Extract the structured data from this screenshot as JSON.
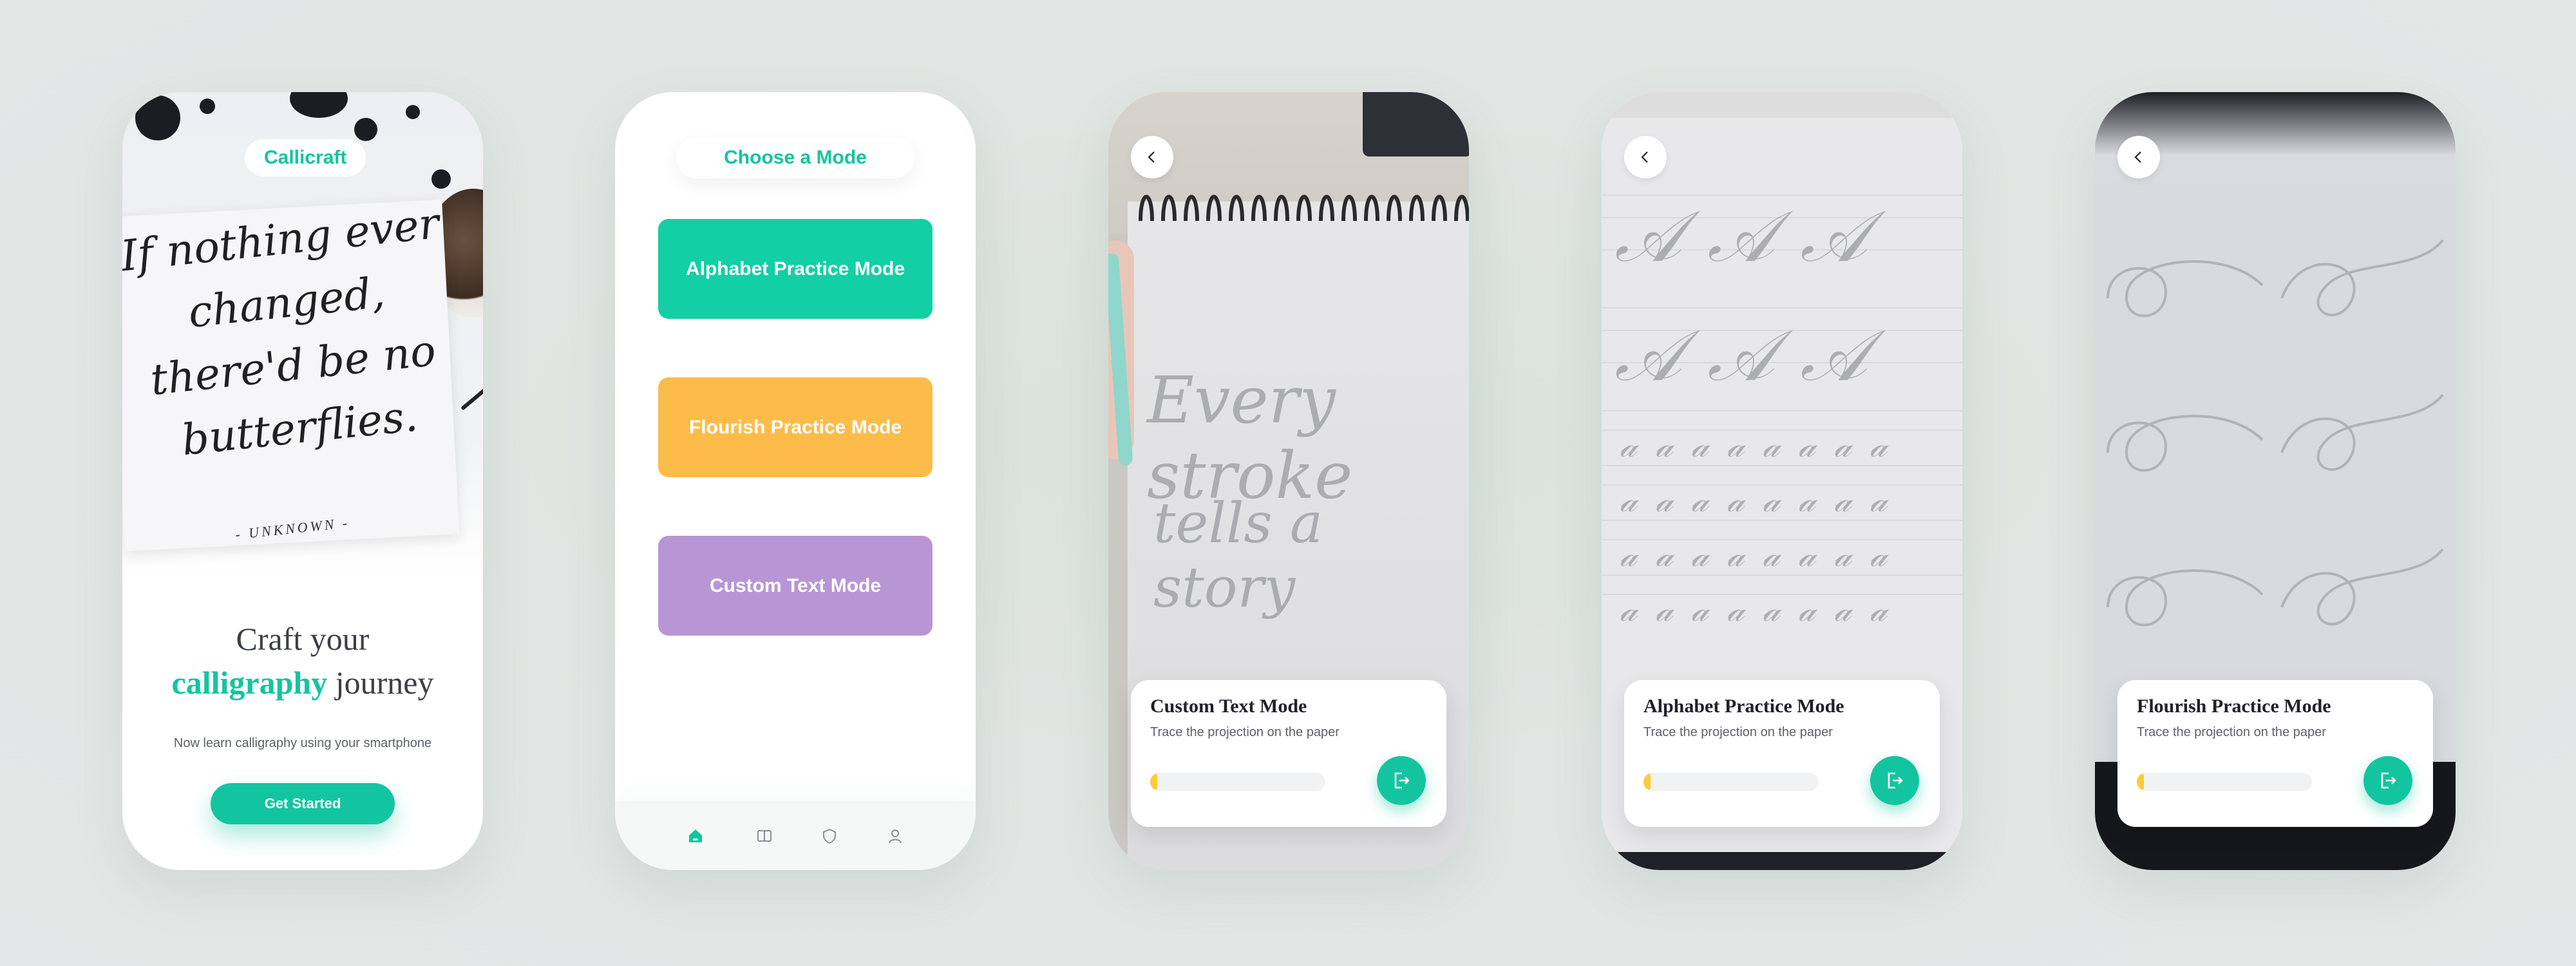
{
  "colors": {
    "accent": "#12c5a0",
    "alphabet": "#12cfa6",
    "flourish": "#fdbc49",
    "custom": "#b896d6",
    "progress": "#fdcb3c"
  },
  "onboarding": {
    "logo": "Callicraft",
    "quote_lines": [
      "If nothing ever",
      "changed,",
      "there'd be no",
      "butterflies."
    ],
    "quote_author": "- UNKNOWN -",
    "headline_line1": "Craft your",
    "headline_accent": "calligraphy",
    "headline_rest": "journey",
    "subtitle": "Now learn calligraphy using your smartphone",
    "cta": "Get Started"
  },
  "modes": {
    "title": "Choose a Mode",
    "items": [
      {
        "label": "Alphabet Practice Mode"
      },
      {
        "label": "Flourish Practice Mode"
      },
      {
        "label": "Custom Text Mode"
      }
    ],
    "nav": [
      {
        "icon": "home-icon",
        "active": true
      },
      {
        "icon": "book-icon",
        "active": false
      },
      {
        "icon": "shield-icon",
        "active": false
      },
      {
        "icon": "profile-icon",
        "active": false
      }
    ]
  },
  "custom_screen": {
    "projection_lines": [
      "Every stroke",
      "tells a story"
    ],
    "card_title": "Custom Text Mode",
    "card_subtitle": "Trace the projection on the paper",
    "progress": 0.04
  },
  "alphabet_screen": {
    "card_title": "Alphabet Practice Mode",
    "card_subtitle": "Trace the projection on the paper",
    "progress": 0.04
  },
  "flourish_screen": {
    "card_title": "Flourish Practice Mode",
    "card_subtitle": "Trace the projection on the paper",
    "progress": 0.04
  }
}
